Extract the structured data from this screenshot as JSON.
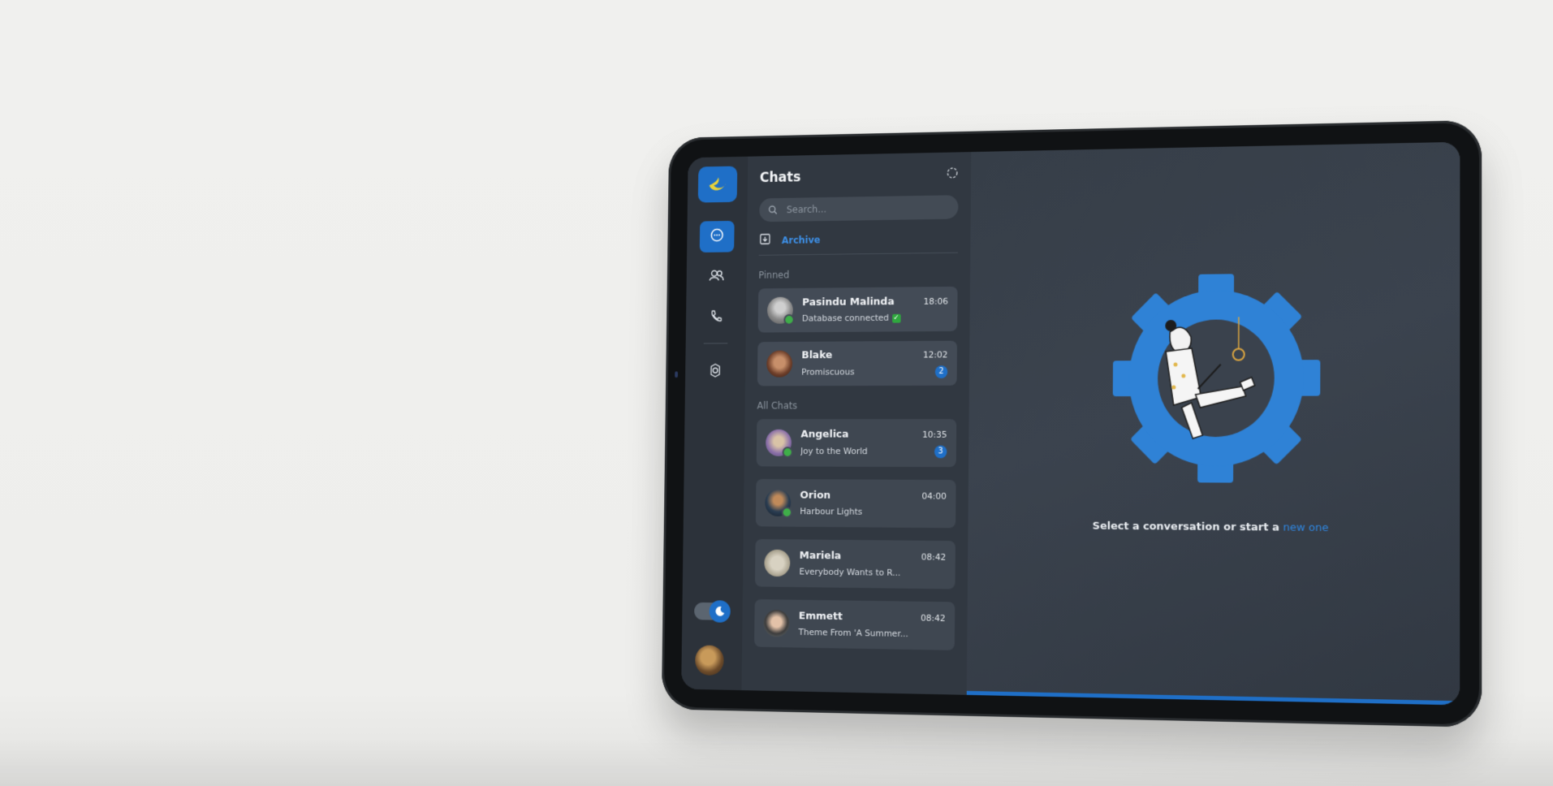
{
  "sidebar": {
    "logo_icon": "logo-icon",
    "items": [
      {
        "name": "messages",
        "icon": "chat-bubble-icon",
        "active": true
      },
      {
        "name": "contacts",
        "icon": "users-icon",
        "active": false
      },
      {
        "name": "calls",
        "icon": "phone-icon",
        "active": false
      },
      {
        "name": "settings",
        "icon": "gear-icon",
        "active": false
      }
    ],
    "theme_toggle_icon": "moon-icon"
  },
  "chats": {
    "title": "Chats",
    "search_placeholder": "Search...",
    "archive_label": "Archive",
    "pinned_label": "Pinned",
    "all_label": "All Chats",
    "pinned": [
      {
        "name": "Pasindu Malinda",
        "time": "18:06",
        "preview": "Database connected",
        "checkmark": true,
        "badge": "",
        "online": true
      },
      {
        "name": "Blake",
        "time": "12:02",
        "preview": "Promiscuous",
        "badge": "2",
        "online": false
      }
    ],
    "all": [
      {
        "name": "Angelica",
        "time": "10:35",
        "preview": "Joy to the World",
        "badge": "3",
        "online": true
      },
      {
        "name": "Orion",
        "time": "04:00",
        "preview": "Harbour Lights",
        "badge": "",
        "online": true
      },
      {
        "name": "Mariela",
        "time": "08:42",
        "preview": "Everybody Wants to R...",
        "badge": "",
        "online": false
      },
      {
        "name": "Emmett",
        "time": "08:42",
        "preview": "Theme From 'A Summer...",
        "badge": "",
        "online": false
      }
    ]
  },
  "main": {
    "prompt_text": "Select a conversation or start a",
    "prompt_link": "new one"
  },
  "colors": {
    "accent": "#1f6fc7",
    "link": "#2f86e0",
    "online": "#3fae49"
  }
}
